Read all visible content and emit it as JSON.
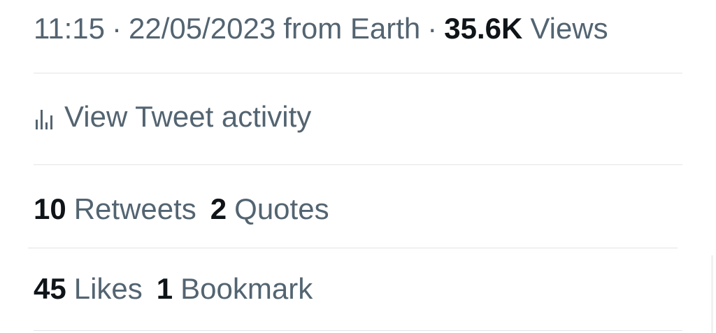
{
  "tweet_meta": {
    "time": "11:15",
    "date": "22/05/2023",
    "source": "from Earth",
    "separator": "·",
    "views_count": "35.6K",
    "views_label": "Views"
  },
  "activity": {
    "icon": "bar-chart-icon",
    "label": "View Tweet activity"
  },
  "engagement": {
    "retweets_count": "10",
    "retweets_label": "Retweets",
    "quotes_count": "2",
    "quotes_label": "Quotes",
    "likes_count": "45",
    "likes_label": "Likes",
    "bookmarks_count": "1",
    "bookmarks_label": "Bookmark"
  },
  "colors": {
    "secondary_text": "#536471",
    "primary_text": "#0f1419",
    "divider": "#e1e4e7",
    "background": "#ffffff"
  }
}
